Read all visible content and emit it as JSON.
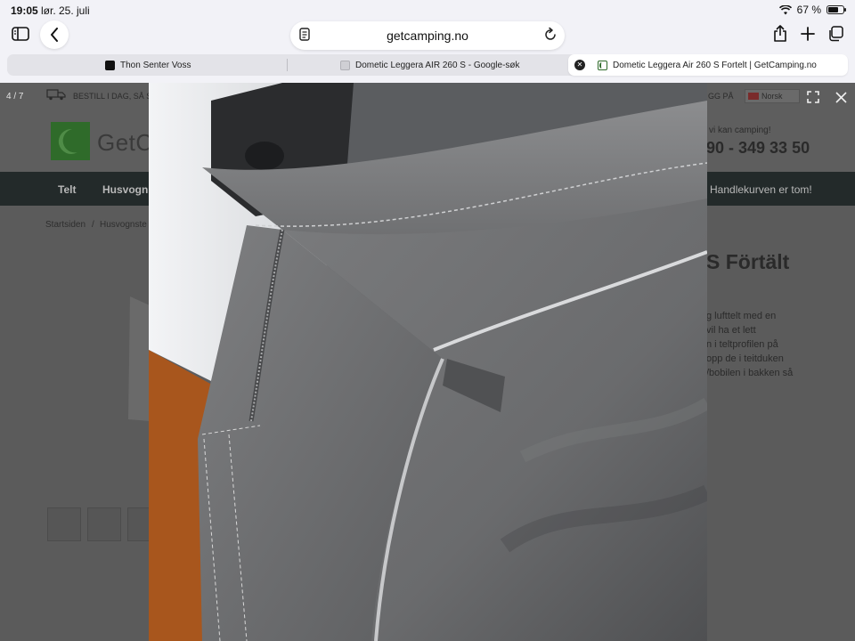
{
  "status_bar": {
    "time": "19:05",
    "date": "lør. 25. juli",
    "battery_percent": "67 %",
    "battery_level": 0.67
  },
  "toolbar": {
    "url": "getcamping.no",
    "icons": [
      "sidebar-icon",
      "back-icon",
      "reader-icon",
      "reload-icon",
      "share-icon",
      "new-tab-icon",
      "tabs-icon"
    ]
  },
  "tabs": [
    {
      "title": "Thon Senter Voss",
      "active": false
    },
    {
      "title": "Dometic Leggera AIR 260 S - Google-søk",
      "active": false
    },
    {
      "title": "Dometic Leggera Air 260 S Fortelt | GetCamping.no",
      "active": true
    }
  ],
  "page": {
    "promo": "BESTILL I DAG, SÅ SEN",
    "promo_right": "GG PÅ",
    "language": "Norsk",
    "logo_text": "GetC",
    "tagline": "vi kan camping!",
    "phone": "90 - 349 33 50",
    "nav": [
      "Telt",
      "Husvogn"
    ],
    "cart": "Handlekurven er tom!",
    "breadcrumb": [
      "Startsiden",
      "Husvognste"
    ],
    "title_fragment": "S Förtält",
    "description_lines": [
      "g lufttelt med en",
      "vil ha et lett",
      "n i teltprofilen på",
      "opp de i teitduken",
      "/bobilen i bakken så"
    ]
  },
  "lightbox": {
    "counter": "4 / 7",
    "icons": [
      "fullscreen-icon",
      "close-icon"
    ]
  },
  "colors": {
    "accent_green": "#2f6b2a",
    "nav_dark": "#232a2a",
    "tent_gray": "#6b6c6e"
  }
}
